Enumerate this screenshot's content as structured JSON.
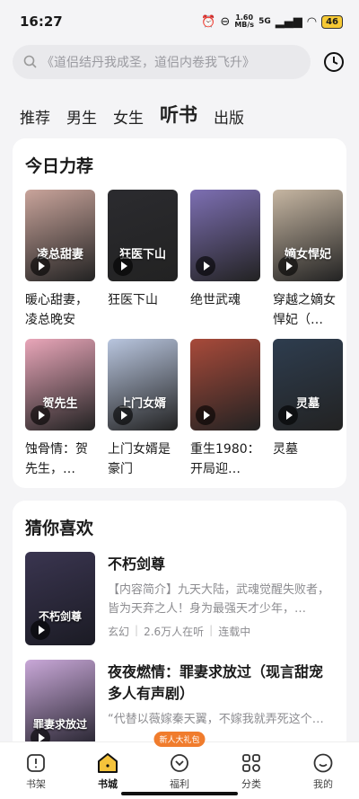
{
  "status": {
    "time": "16:27",
    "net_speed_top": "1.60",
    "net_speed_bottom": "MB/s",
    "signal": "5G",
    "battery": "46"
  },
  "search": {
    "placeholder": "《道侣结丹我成圣，道侣内卷我飞升》"
  },
  "tabs": [
    "推荐",
    "男生",
    "女生",
    "听书",
    "出版"
  ],
  "active_tab_index": 3,
  "today": {
    "title": "今日力荐",
    "books": [
      {
        "title": "暖心甜妻，凌总晚安",
        "cover_text": "凌总甜妻",
        "color": "#c9a49b"
      },
      {
        "title": "狂医下山",
        "cover_text": "狂医下山",
        "color": "#2b2b2f"
      },
      {
        "title": "绝世武魂",
        "cover_text": "",
        "color": "#7d6fb3"
      },
      {
        "title": "穿越之嫡女悍妃（…",
        "cover_text": "嫡女悍妃",
        "color": "#c6b6a2"
      },
      {
        "title": "蚀骨情：贺先生，…",
        "cover_text": "贺先生",
        "color": "#e9a6b9"
      },
      {
        "title": "上门女婿是豪门",
        "cover_text": "上门女婿",
        "color": "#b9c6df"
      },
      {
        "title": "重生1980：开局迎…",
        "cover_text": "",
        "color": "#a84a3a"
      },
      {
        "title": "灵墓",
        "cover_text": "灵墓",
        "color": "#2e3d4f"
      }
    ]
  },
  "guess": {
    "title": "猜你喜欢",
    "items": [
      {
        "title": "不朽剑尊",
        "desc": "【内容简介】九天大陆，武魂觉醒失败者，皆为天弃之人！身为最强天才少年，…",
        "genre": "玄幻",
        "listeners": "2.6万人在听",
        "status": "连载中",
        "cover_text": "不朽剑尊",
        "color": "#3a3550"
      },
      {
        "title": "夜夜燃情：罪妻求放过（现言甜宠多人有声剧）",
        "desc": "“代替以薇嫁秦天翼，不嫁我就弄死这个…",
        "genre": "",
        "listeners": "",
        "status": "",
        "cover_text": "罪妻求放过",
        "color": "#c9a8d8"
      }
    ]
  },
  "nav": {
    "items": [
      "书架",
      "书城",
      "福利",
      "分类",
      "我的"
    ],
    "active_index": 1,
    "gift_badge": "新人大礼包"
  }
}
